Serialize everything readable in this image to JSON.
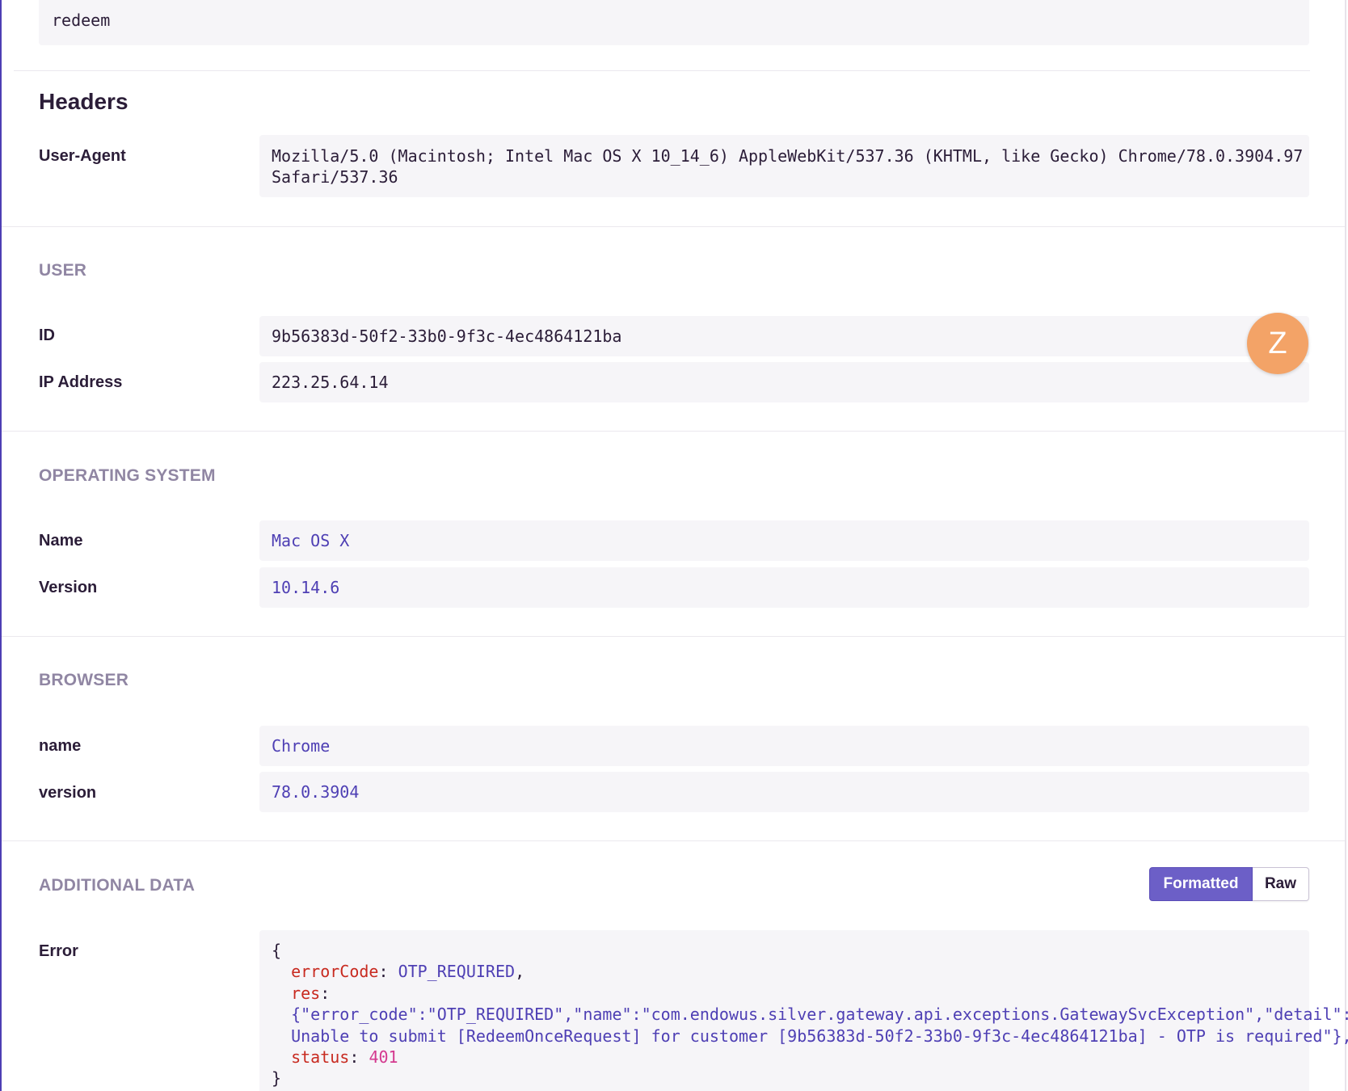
{
  "top": {
    "value": "redeem"
  },
  "headers": {
    "title": "Headers",
    "user_agent_label": "User-Agent",
    "user_agent_line1": "Mozilla/5.0 (Macintosh; Intel Mac OS X 10_14_6) AppleWebKit/537.36 (KHTML, like Gecko) Chrome/78.0.3904.97",
    "user_agent_line2": "Safari/537.36"
  },
  "user": {
    "title": "USER",
    "id_label": "ID",
    "id_value": "9b56383d-50f2-33b0-9f3c-4ec4864121ba",
    "ip_label": "IP Address",
    "ip_value": "223.25.64.14",
    "avatar_letter": "Z"
  },
  "os": {
    "title": "OPERATING SYSTEM",
    "name_label": "Name",
    "name_value": "Mac OS X",
    "version_label": "Version",
    "version_value": "10.14.6"
  },
  "browser": {
    "title": "BROWSER",
    "name_label": "name",
    "name_value": "Chrome",
    "version_label": "version",
    "version_value": "78.0.3904"
  },
  "additional": {
    "title": "ADDITIONAL DATA",
    "formatted_label": "Formatted",
    "raw_label": "Raw",
    "error_label": "Error",
    "code": {
      "open_brace": "{",
      "error_code_key": "errorCode",
      "error_code_value": "OTP_REQUIRED",
      "res_key": "res",
      "res_line1": "{\"error_code\":\"OTP_REQUIRED\",\"name\":\"com.endowus.silver.gateway.api.exceptions.GatewaySvcException\",\"detail\":\"",
      "res_line2": "Unable to submit [RedeemOnceRequest] for customer [9b56383d-50f2-33b0-9f3c-4ec4864121ba] - OTP is required\"},",
      "status_key": "status",
      "status_value": "401",
      "close_brace": "}"
    }
  },
  "colors": {
    "accent": "#6c5fc7",
    "link": "#4e3fb4",
    "section_title": "#9086a3",
    "avatar": "#f3a367",
    "code_key": "#c82a20",
    "code_number": "#d4398f"
  }
}
